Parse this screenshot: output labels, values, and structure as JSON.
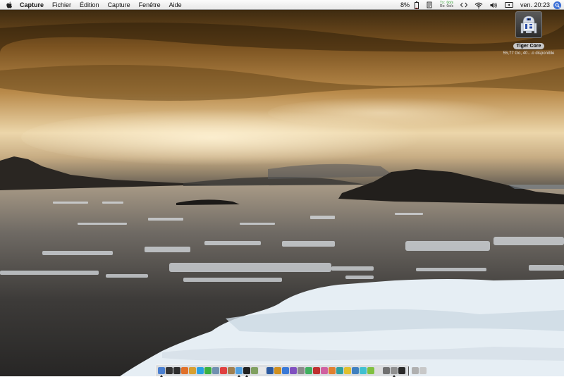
{
  "menubar": {
    "apple_icon": "apple-icon",
    "app_name": "Capture",
    "menus": [
      "Fichier",
      "Édition",
      "Capture",
      "Fenêtre",
      "Aide"
    ],
    "status": {
      "battery_percent": "8%",
      "network_rx": "0o/s",
      "network_tx": "0o/s",
      "net_label_tx": "Tx:",
      "net_label_rx": "Rx:",
      "net_rate_top": "0o/s",
      "net_rate_bottom": "0o/s",
      "clock": "ven. 20:23",
      "icons": [
        "battery-icon",
        "script-icon",
        "network-monitor-icon",
        "sync-arrows-icon",
        "wifi-icon",
        "volume-icon",
        "display-icon",
        "spotlight-icon"
      ]
    }
  },
  "desktop": {
    "disk": {
      "name": "Tiger Core",
      "info": "55,77 Go, 40…o disponible",
      "icon": "r2d2-drive-icon"
    }
  },
  "dock": {
    "items": [
      {
        "icon": "finder-icon",
        "color": "#4a7fd0",
        "running": true
      },
      {
        "icon": "dashboard-icon",
        "color": "#333333",
        "running": false
      },
      {
        "icon": "spiral-app-icon",
        "color": "#2d2d2d",
        "running": false
      },
      {
        "icon": "firefox-icon",
        "color": "#e0702a",
        "running": false
      },
      {
        "icon": "bird-app-icon",
        "color": "#d8a030",
        "running": false
      },
      {
        "icon": "skype-icon",
        "color": "#2aa0e0",
        "running": false
      },
      {
        "icon": "itunes-icon",
        "color": "#3ab040",
        "running": false
      },
      {
        "icon": "mail-icon",
        "color": "#7090b0",
        "running": false
      },
      {
        "icon": "ical-icon",
        "color": "#e04040",
        "running": false
      },
      {
        "icon": "address-book-icon",
        "color": "#a08050",
        "running": false
      },
      {
        "icon": "ichat-icon",
        "color": "#50a0e0",
        "running": true
      },
      {
        "icon": "terminal-icon",
        "color": "#222222",
        "running": true
      },
      {
        "icon": "preview-icon",
        "color": "#80a060",
        "running": false
      },
      {
        "icon": "textedit-icon",
        "color": "#e8e8e8",
        "running": false
      },
      {
        "icon": "photoshop-icon",
        "color": "#2c5aa0",
        "running": false
      },
      {
        "icon": "illustrator-icon",
        "color": "#d09020",
        "running": false
      },
      {
        "icon": "blue-app-icon",
        "color": "#3a7ad8",
        "running": false
      },
      {
        "icon": "purple-app-icon",
        "color": "#8050c0",
        "running": false
      },
      {
        "icon": "gear-app-icon",
        "color": "#8a8a8a",
        "running": false
      },
      {
        "icon": "green-app-icon",
        "color": "#40b060",
        "running": false
      },
      {
        "icon": "red-app-icon",
        "color": "#c03030",
        "running": false
      },
      {
        "icon": "pink-app-icon",
        "color": "#d060a0",
        "running": false
      },
      {
        "icon": "orange-app-icon",
        "color": "#e08030",
        "running": false
      },
      {
        "icon": "teal-app-icon",
        "color": "#30a0a0",
        "running": false
      },
      {
        "icon": "yellow-app-icon",
        "color": "#e0c030",
        "running": false
      },
      {
        "icon": "globe-app-icon",
        "color": "#4080c0",
        "running": false
      },
      {
        "icon": "cyan-app-icon",
        "color": "#40c0d0",
        "running": false
      },
      {
        "icon": "lime-app-icon",
        "color": "#80c040",
        "running": false
      },
      {
        "icon": "white-app-icon",
        "color": "#dddddd",
        "running": false
      },
      {
        "icon": "gray-app-icon",
        "color": "#707070",
        "running": false
      },
      {
        "icon": "capture-icon",
        "color": "#909090",
        "running": true
      },
      {
        "icon": "activity-monitor-icon",
        "color": "#2a2a2a",
        "running": false
      }
    ],
    "tail_items": [
      {
        "icon": "magnifier-icon",
        "color": "#b0b0b0"
      },
      {
        "icon": "trash-icon",
        "color": "#c8c8c8"
      }
    ]
  }
}
